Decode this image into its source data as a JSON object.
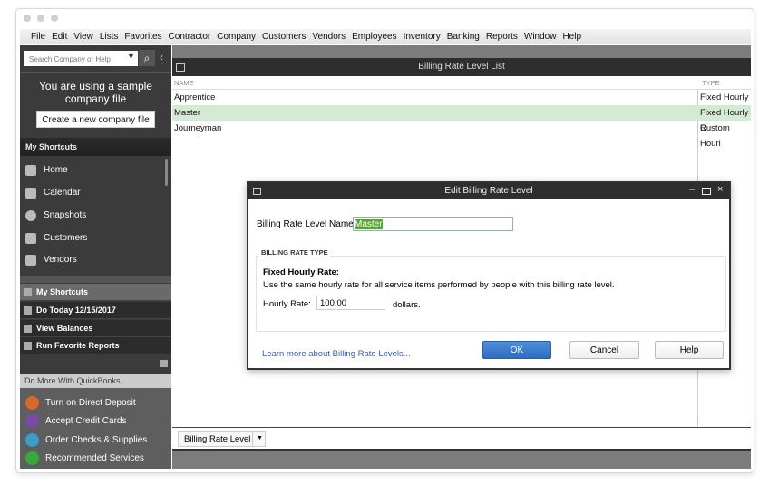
{
  "menu": [
    "File",
    "Edit",
    "View",
    "Lists",
    "Favorites",
    "Contractor",
    "Company",
    "Customers",
    "Vendors",
    "Employees",
    "Inventory",
    "Banking",
    "Reports",
    "Window",
    "Help"
  ],
  "left": {
    "search_placeholder": "Search Company or Help",
    "sample_text": "You are using a sample company file",
    "create_button": "Create a new company file",
    "shortcuts_title": "My Shortcuts",
    "shortcuts": [
      "Home",
      "Calendar",
      "Snapshots",
      "Customers",
      "Vendors"
    ],
    "tabs": [
      "My Shortcuts",
      "Do Today 12/15/2017",
      "View Balances",
      "Run Favorite Reports"
    ],
    "do_more_title": "Do More With QuickBooks",
    "do_more": [
      {
        "label": "Turn on Direct Deposit",
        "color": "#d8692a"
      },
      {
        "label": "Accept Credit Cards",
        "color": "#7a4aa8"
      },
      {
        "label": "Order Checks & Supplies",
        "color": "#3a9ec6"
      },
      {
        "label": "Recommended Services",
        "color": "#3aa83a"
      }
    ]
  },
  "list": {
    "title": "Billing Rate Level List",
    "columns": [
      "NAME",
      "TYPE"
    ],
    "rows": [
      {
        "name": "Apprentice",
        "type": "Fixed Hourly R"
      },
      {
        "name": "Master",
        "type": "Fixed Hourly R"
      },
      {
        "name": "Journeyman",
        "type": "Custom Hourl"
      }
    ],
    "bottom_button": "Billing Rate Level"
  },
  "dialog": {
    "title": "Edit Billing Rate Level",
    "name_label": "Billing Rate Level Name",
    "name_value": "Master",
    "group_title": "BILLING RATE TYPE",
    "rate_type": "Fixed Hourly Rate:",
    "description": "Use the same hourly rate for all service items performed by people with this billing rate level.",
    "hourly_label": "Hourly Rate:",
    "hourly_value": "100.00",
    "unit": "dollars.",
    "learn_more": "Learn more about Billing Rate Levels...",
    "ok": "OK",
    "cancel": "Cancel",
    "help": "Help"
  }
}
